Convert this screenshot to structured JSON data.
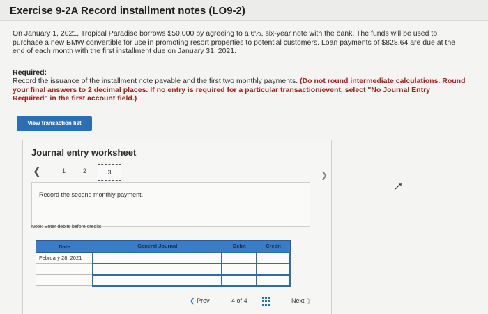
{
  "page": {
    "title": "Exercise 9-2A Record installment notes (LO9-2)",
    "problem": "On January 1, 2021, Tropical Paradise borrows $50,000 by agreeing to a 6%, six-year note with the bank. The funds will be used to purchase a new BMW convertible for use in promoting resort properties to potential customers. Loan payments of $828.64 are due at the end of each month with the first installment due on January 31, 2021.",
    "required_heading": "Required:",
    "required_text": "Record the issuance of the installment note payable and the first two monthly payments.",
    "required_bold": "(Do not round intermediate calculations. Round your final answers to 2 decimal places. If no entry is required for a particular transaction/event, select \"No Journal Entry Required\" in the first account field.)"
  },
  "view_button": {
    "label": "View transaction list"
  },
  "worksheet": {
    "title": "Journal entry worksheet",
    "steps": [
      "1",
      "2",
      "3"
    ],
    "active_step": "3",
    "instruction": "Record the second monthly payment.",
    "note": "Note: Enter debits before credits.",
    "table": {
      "headers": [
        "Date",
        "General Journal",
        "Debit",
        "Credit"
      ],
      "rows": [
        [
          "February 28, 2021",
          "",
          "",
          ""
        ],
        [
          "",
          "",
          "",
          ""
        ],
        [
          "",
          "",
          "",
          ""
        ]
      ]
    }
  },
  "pager": {
    "prev_label": "Prev",
    "current": "4",
    "of_label": "of",
    "total": "4",
    "next_label": "Next"
  },
  "icons": {
    "prev": "chevron-left-icon",
    "next": "chevron-right-icon",
    "grid": "grid-icon",
    "cursor": "mouse-pointer-icon"
  },
  "colors": {
    "accent": "#2b6fb3",
    "header_blue": "#3a7dc6",
    "required_red": "#a51d1d"
  }
}
